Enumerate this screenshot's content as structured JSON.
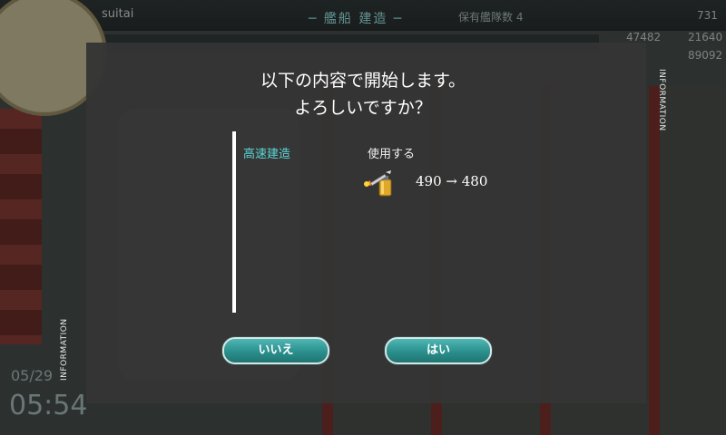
{
  "header": {
    "title": "─ 艦船 建造 ─",
    "player_name": "suitai",
    "ship_count_label": "保有艦隊数 4",
    "resources": [
      "731",
      "47482",
      "21640",
      "89092"
    ]
  },
  "clock": {
    "date": "05/29",
    "time": "05:54"
  },
  "dialog": {
    "info_tab_label": "INFORMATION",
    "message_line1": "以下の内容で開始します。",
    "message_line2": "よろしいですか？",
    "option_label": "高速建造",
    "use_label": "使用する",
    "item_icon": "flamethrower-icon",
    "count_change": "490 → 480",
    "no_label": "いいえ",
    "yes_label": "はい"
  },
  "colors": {
    "accent": "#5ed7d7",
    "button": "#2a8f8d",
    "panel": "#343534"
  }
}
